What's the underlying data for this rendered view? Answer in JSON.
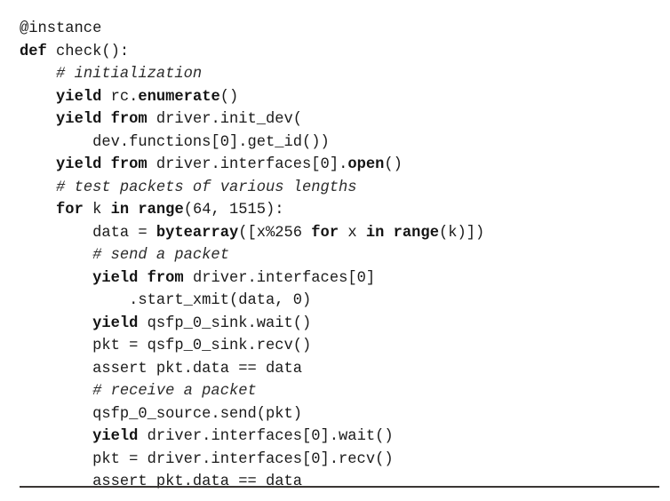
{
  "listing": {
    "language": "python",
    "font_color": "#1a1a1a",
    "background_color": "#ffffff",
    "rule_color": "#3a3634",
    "lines": [
      {
        "indent": 0,
        "tokens": [
          {
            "text": "@instance",
            "style": "plain"
          }
        ]
      },
      {
        "indent": 0,
        "tokens": [
          {
            "text": "def",
            "style": "kw"
          },
          {
            "text": " check():",
            "style": "plain"
          }
        ]
      },
      {
        "indent": 4,
        "tokens": [
          {
            "text": "# initialization",
            "style": "comment"
          }
        ]
      },
      {
        "indent": 4,
        "tokens": [
          {
            "text": "yield",
            "style": "kw"
          },
          {
            "text": " rc.",
            "style": "plain"
          },
          {
            "text": "enumerate",
            "style": "builtin"
          },
          {
            "text": "()",
            "style": "plain"
          }
        ]
      },
      {
        "indent": 4,
        "tokens": [
          {
            "text": "yield",
            "style": "kw"
          },
          {
            "text": " ",
            "style": "plain"
          },
          {
            "text": "from",
            "style": "kw"
          },
          {
            "text": " driver.init_dev(",
            "style": "plain"
          }
        ]
      },
      {
        "indent": 8,
        "tokens": [
          {
            "text": "dev.functions[0].get_id())",
            "style": "plain"
          }
        ]
      },
      {
        "indent": 4,
        "tokens": [
          {
            "text": "yield",
            "style": "kw"
          },
          {
            "text": " ",
            "style": "plain"
          },
          {
            "text": "from",
            "style": "kw"
          },
          {
            "text": " driver.interfaces[0].",
            "style": "plain"
          },
          {
            "text": "open",
            "style": "builtin"
          },
          {
            "text": "()",
            "style": "plain"
          }
        ]
      },
      {
        "indent": 4,
        "tokens": [
          {
            "text": "# test packets of various lengths",
            "style": "comment"
          }
        ]
      },
      {
        "indent": 4,
        "tokens": [
          {
            "text": "for",
            "style": "kw"
          },
          {
            "text": " k ",
            "style": "plain"
          },
          {
            "text": "in",
            "style": "kw"
          },
          {
            "text": " ",
            "style": "plain"
          },
          {
            "text": "range",
            "style": "builtin"
          },
          {
            "text": "(64, 1515):",
            "style": "plain"
          }
        ]
      },
      {
        "indent": 8,
        "tokens": [
          {
            "text": "data = ",
            "style": "plain"
          },
          {
            "text": "bytearray",
            "style": "builtin"
          },
          {
            "text": "([x%256 ",
            "style": "plain"
          },
          {
            "text": "for",
            "style": "kw"
          },
          {
            "text": " x ",
            "style": "plain"
          },
          {
            "text": "in",
            "style": "kw"
          },
          {
            "text": " ",
            "style": "plain"
          },
          {
            "text": "range",
            "style": "builtin"
          },
          {
            "text": "(k)])",
            "style": "plain"
          }
        ]
      },
      {
        "indent": 8,
        "tokens": [
          {
            "text": "# send a packet",
            "style": "comment"
          }
        ]
      },
      {
        "indent": 8,
        "tokens": [
          {
            "text": "yield",
            "style": "kw"
          },
          {
            "text": " ",
            "style": "plain"
          },
          {
            "text": "from",
            "style": "kw"
          },
          {
            "text": " driver.interfaces[0]",
            "style": "plain"
          }
        ]
      },
      {
        "indent": 12,
        "tokens": [
          {
            "text": ".start_xmit(data, 0)",
            "style": "plain"
          }
        ]
      },
      {
        "indent": 8,
        "tokens": [
          {
            "text": "yield",
            "style": "kw"
          },
          {
            "text": " qsfp_0_sink.wait()",
            "style": "plain"
          }
        ]
      },
      {
        "indent": 8,
        "tokens": [
          {
            "text": "pkt = qsfp_0_sink.recv()",
            "style": "plain"
          }
        ]
      },
      {
        "indent": 8,
        "tokens": [
          {
            "text": "assert pkt.data == data",
            "style": "plain"
          }
        ]
      },
      {
        "indent": 8,
        "tokens": [
          {
            "text": "# receive a packet",
            "style": "comment"
          }
        ]
      },
      {
        "indent": 8,
        "tokens": [
          {
            "text": "qsfp_0_source.send(pkt)",
            "style": "plain"
          }
        ]
      },
      {
        "indent": 8,
        "tokens": [
          {
            "text": "yield",
            "style": "kw"
          },
          {
            "text": " driver.interfaces[0].wait()",
            "style": "plain"
          }
        ]
      },
      {
        "indent": 8,
        "tokens": [
          {
            "text": "pkt = driver.interfaces[0].recv()",
            "style": "plain"
          }
        ]
      },
      {
        "indent": 8,
        "tokens": [
          {
            "text": "assert pkt.data == data",
            "style": "plain"
          }
        ]
      }
    ]
  }
}
